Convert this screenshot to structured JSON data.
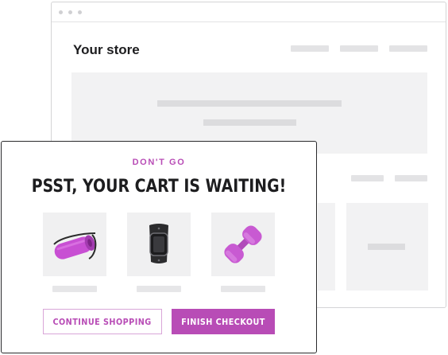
{
  "store": {
    "title": "Your store"
  },
  "popup": {
    "eyebrow": "DON'T GO",
    "headline": "PSST, YOUR CART IS WAITING!",
    "products": [
      {
        "icon": "yoga-mat-icon"
      },
      {
        "icon": "fitness-tracker-icon"
      },
      {
        "icon": "dumbbell-icon"
      }
    ],
    "continue_label": "CONTINUE SHOPPING",
    "checkout_label": "FINISH CHECKOUT"
  },
  "colors": {
    "accent": "#b84cb6",
    "placeholder": "#e3e3e5",
    "panel": "#f2f2f3",
    "text": "#1d1d1f"
  }
}
